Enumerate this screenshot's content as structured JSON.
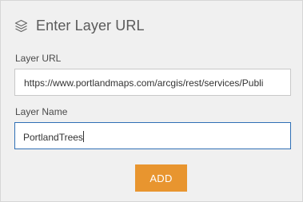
{
  "header": {
    "icon": "layers-icon",
    "title": "Enter Layer URL"
  },
  "form": {
    "url_label": "Layer URL",
    "url_value": "https://www.portlandmaps.com/arcgis/rest/services/Publi",
    "name_label": "Layer Name",
    "name_value": "PortlandTrees",
    "add_label": "ADD"
  },
  "colors": {
    "panel_background": "#f0f0f0",
    "accent_button": "#e8952f",
    "focus_border": "#2f6fb5"
  }
}
